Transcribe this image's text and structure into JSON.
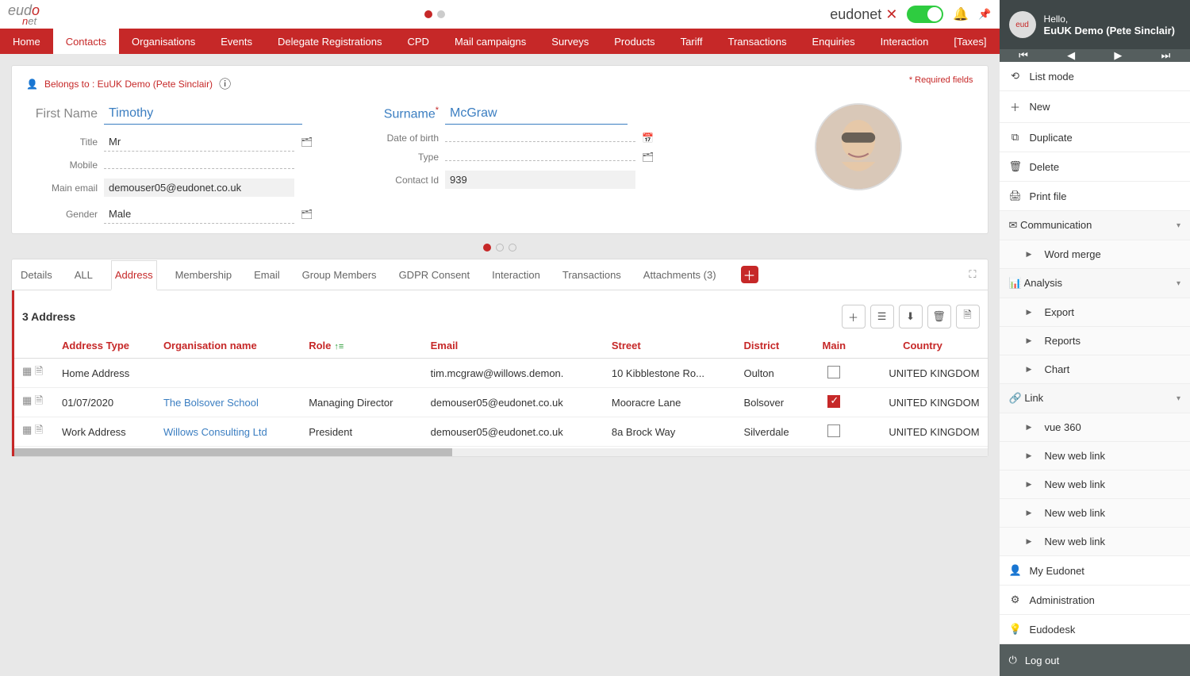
{
  "logo": "eudonet",
  "brand2": "eudonet",
  "tabs": [
    "Home",
    "Contacts",
    "Organisations",
    "Events",
    "Delegate Registrations",
    "CPD",
    "Mail campaigns",
    "Surveys",
    "Products",
    "Tariff",
    "Transactions",
    "Enquiries",
    "Interaction",
    "[Taxes]"
  ],
  "active_tab": 1,
  "belongs": {
    "prefix": "Belongs to :",
    "value": "EuUK Demo (Pete Sinclair)"
  },
  "required_label": "* Required fields",
  "fields": {
    "first_name": {
      "label": "First Name",
      "value": "Timothy"
    },
    "surname": {
      "label": "Surname",
      "value": "McGraw"
    },
    "title": {
      "label": "Title",
      "value": "Mr"
    },
    "dob": {
      "label": "Date of birth",
      "value": ""
    },
    "mobile": {
      "label": "Mobile",
      "value": ""
    },
    "type": {
      "label": "Type",
      "value": ""
    },
    "email": {
      "label": "Main email",
      "value": "demouser05@eudonet.co.uk"
    },
    "contact_id": {
      "label": "Contact Id",
      "value": "939"
    },
    "gender": {
      "label": "Gender",
      "value": "Male"
    }
  },
  "subtabs": [
    "Details",
    "ALL",
    "Address",
    "Membership",
    "Email",
    "Group Members",
    "GDPR Consent",
    "Interaction",
    "Transactions",
    "Attachments (3)"
  ],
  "active_subtab": 2,
  "table": {
    "title": "3 Address",
    "columns": [
      "Address Type",
      "Organisation name",
      "Role",
      "Email",
      "Street",
      "District",
      "Main",
      "Country"
    ],
    "rows": [
      {
        "type": "Home Address",
        "org": "",
        "role": "",
        "email": "tim.mcgraw@willows.demon.",
        "street": "10 Kibblestone Ro...",
        "district": "Oulton",
        "main": false,
        "country": "UNITED KINGDOM"
      },
      {
        "type": "01/07/2020",
        "org": "The Bolsover School",
        "role": "Managing Director",
        "email": "demouser05@eudonet.co.uk",
        "street": "Mooracre Lane",
        "district": "Bolsover",
        "main": true,
        "country": "UNITED KINGDOM"
      },
      {
        "type": "Work Address",
        "org": "Willows Consulting Ltd",
        "role": "President",
        "email": "demouser05@eudonet.co.uk",
        "street": "8a Brock Way",
        "district": "Silverdale",
        "main": false,
        "country": "UNITED KINGDOM"
      }
    ]
  },
  "side": {
    "hello": "Hello,",
    "user": "EuUK Demo (Pete Sinclair)",
    "items": [
      {
        "icon": "⟲",
        "label": "List mode"
      },
      {
        "icon": "＋",
        "label": "New"
      },
      {
        "icon": "⧉",
        "label": "Duplicate"
      },
      {
        "icon": "🗑",
        "label": "Delete"
      },
      {
        "icon": "🖨",
        "label": "Print file"
      }
    ],
    "groups": [
      {
        "icon": "✉",
        "label": "Communication",
        "items": [
          "Word merge"
        ]
      },
      {
        "icon": "📊",
        "label": "Analysis",
        "items": [
          "Export",
          "Reports",
          "Chart"
        ]
      },
      {
        "icon": "🔗",
        "label": "Link",
        "items": [
          "vue 360",
          "New web link",
          "New web link",
          "New web link",
          "New web link"
        ]
      }
    ],
    "bottom": [
      {
        "icon": "👤",
        "label": "My Eudonet"
      },
      {
        "icon": "⚙",
        "label": "Administration"
      },
      {
        "icon": "💡",
        "label": "Eudodesk"
      }
    ],
    "logout": "Log out"
  }
}
